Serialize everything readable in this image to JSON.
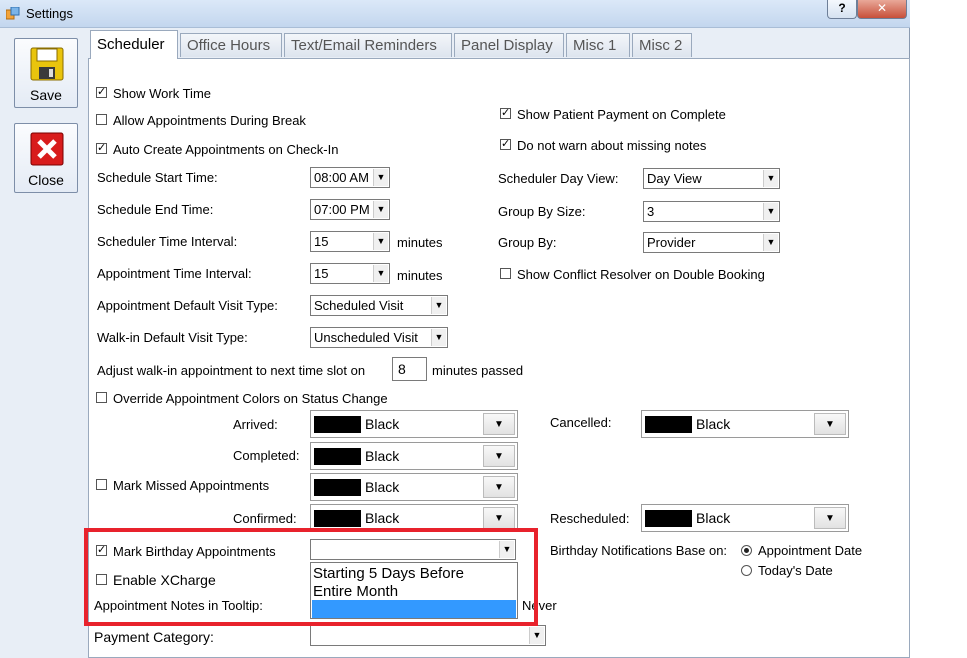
{
  "window": {
    "title": "Settings",
    "help_label": "?",
    "close_glyph": "✕"
  },
  "sidebar": {
    "save_label": "Save",
    "close_label": "Close"
  },
  "tabs": [
    "Scheduler",
    "Office Hours",
    "Text/Email Reminders",
    "Panel Display",
    "Misc 1",
    "Misc 2"
  ],
  "scheduler": {
    "show_work_time": {
      "label": "Show Work Time",
      "checked": true
    },
    "allow_appts_break": {
      "label": "Allow Appointments During Break",
      "checked": false
    },
    "auto_create_checkin": {
      "label": "Auto Create Appointments on Check-In",
      "checked": true
    },
    "show_patient_payment": {
      "label": "Show Patient Payment on Complete",
      "checked": true
    },
    "no_warn_missing_notes": {
      "label": "Do not warn about missing notes",
      "checked": true
    },
    "start_time": {
      "label": "Schedule Start Time:",
      "value": "08:00 AM"
    },
    "end_time": {
      "label": "Schedule End Time:",
      "value": "07:00 PM"
    },
    "time_interval": {
      "label": "Scheduler Time Interval:",
      "value": "15",
      "unit": "minutes"
    },
    "appt_interval": {
      "label": "Appointment Time Interval:",
      "value": "15",
      "unit": "minutes"
    },
    "default_visit": {
      "label": "Appointment Default Visit Type:",
      "value": "Scheduled Visit"
    },
    "walkin_visit": {
      "label": "Walk-in Default Visit Type:",
      "value": "Unscheduled Visit"
    },
    "adjust_walkin": {
      "label": "Adjust walk-in appointment to next time slot on",
      "value": "8",
      "suffix": "minutes passed"
    },
    "day_view": {
      "label": "Scheduler Day View:",
      "value": "Day View"
    },
    "group_size": {
      "label": "Group By Size:",
      "value": "3"
    },
    "group_by": {
      "label": "Group By:",
      "value": "Provider"
    },
    "conflict_resolver": {
      "label": "Show Conflict Resolver on Double Booking",
      "checked": false
    },
    "override_colors": {
      "label": "Override Appointment Colors on Status Change",
      "checked": false
    },
    "arrived": {
      "label": "Arrived:",
      "value": "Black"
    },
    "completed": {
      "label": "Completed:",
      "value": "Black"
    },
    "missed_color": {
      "value": "Black"
    },
    "confirmed": {
      "label": "Confirmed:",
      "value": "Black"
    },
    "cancelled": {
      "label": "Cancelled:",
      "value": "Black"
    },
    "rescheduled": {
      "label": "Rescheduled:",
      "value": "Black"
    },
    "mark_missed": {
      "label": "Mark Missed Appointments",
      "checked": false
    },
    "mark_birthday": {
      "label": "Mark Birthday Appointments",
      "checked": true,
      "value": ""
    },
    "birthday_options": [
      "Starting 5 Days Before",
      "Entire Month",
      ""
    ],
    "birthday_base": {
      "label": "Birthday Notifications Base on:",
      "options": [
        "Appointment Date",
        "Today's Date"
      ],
      "selected": "Appointment Date"
    },
    "enable_xcharge": {
      "label": "Enable XCharge",
      "checked": false
    },
    "notes_tooltip": {
      "label": "Appointment Notes in Tooltip:",
      "value": "Never"
    },
    "payment_category": {
      "label": "Payment Category:",
      "value": ""
    }
  },
  "colors": {
    "highlight_box": "#e8222c",
    "selection": "#3399ff"
  }
}
